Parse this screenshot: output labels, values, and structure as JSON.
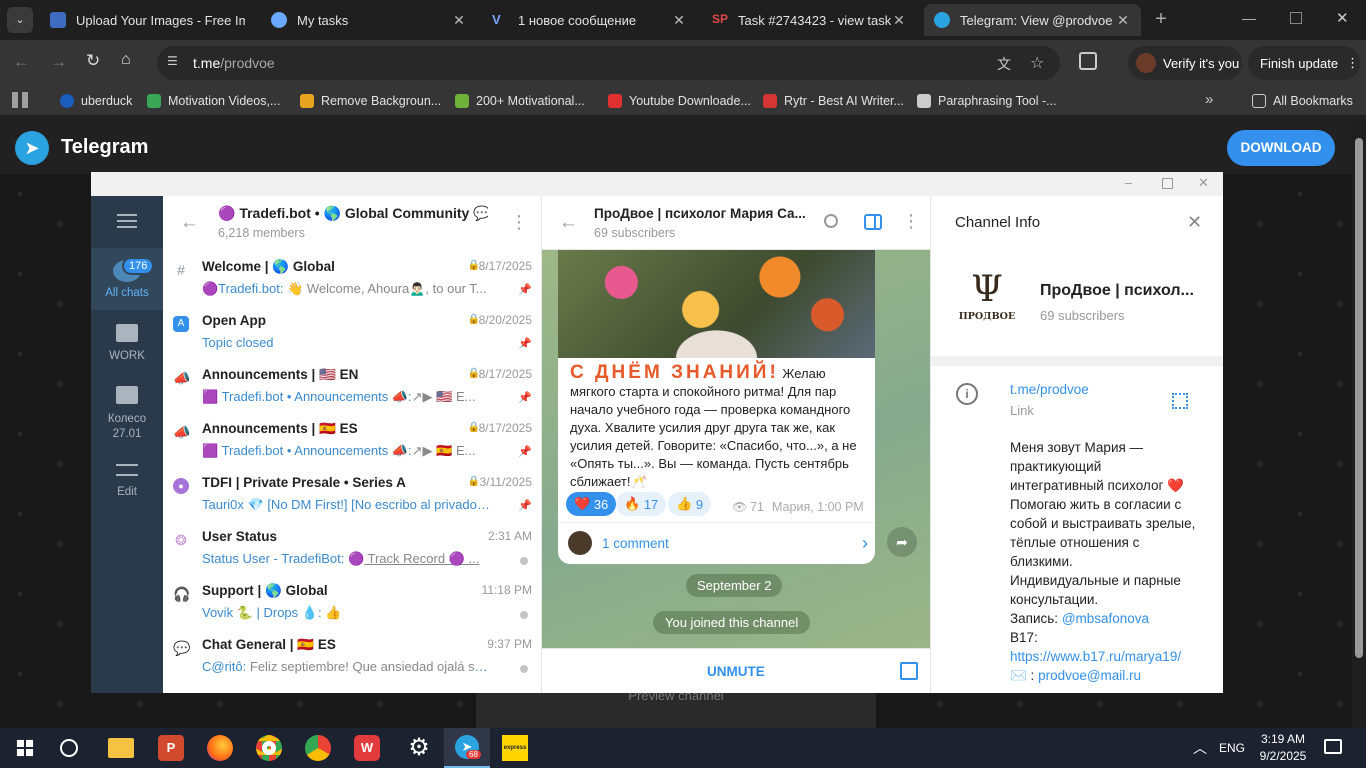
{
  "browser": {
    "tabs": [
      {
        "title": "Upload Your Images - Free Im",
        "favicon_color": "#3d6cc0"
      },
      {
        "title": "My tasks",
        "favicon_color": "#6aa7ff"
      },
      {
        "title": "1 новое сообщение",
        "favicon_color": "#7aa6ff"
      },
      {
        "title": "Task #2743423 - view task",
        "favicon_color": "#e04848"
      },
      {
        "title": "Telegram: View @prodvoe",
        "favicon_color": "#2aa3e0"
      }
    ],
    "url_host": "t.me",
    "url_path": "/prodvoe",
    "profile_label": "Verify it's you",
    "update_label": "Finish update",
    "bookmarks": [
      {
        "label": "uberduck",
        "color": "#1a5dbf"
      },
      {
        "label": "Motivation Videos,...",
        "color": "#3aa657"
      },
      {
        "label": "Remove Backgroun...",
        "color": "#e6a420"
      },
      {
        "label": "200+ Motivational...",
        "color": "#6fb23a"
      },
      {
        "label": "Youtube Downloade...",
        "color": "#e03030"
      },
      {
        "label": "Rytr - Best AI Writer...",
        "color": "#d43535"
      },
      {
        "label": "Paraphrasing Tool -...",
        "color": "#cccccc"
      }
    ],
    "all_bookmarks": "All Bookmarks"
  },
  "telegram_page": {
    "brand": "Telegram",
    "download": "DOWNLOAD",
    "preview_channel": "Preview channel"
  },
  "folders": [
    {
      "label": "All chats",
      "badge": "176"
    },
    {
      "label": "WORK"
    },
    {
      "label": "Колесо 27.01"
    },
    {
      "label": "Edit"
    }
  ],
  "community": {
    "title": "🟣 Tradefi.bot • 🌎 Global Community 💬",
    "members": "6,218 members"
  },
  "chats": [
    {
      "icon": "#",
      "name": "Welcome | 🌎 Global",
      "time": "8/17/2025",
      "preview_sender": "🟣Tradefi.bot:",
      "preview": " 👋 Welcome, Ahoura🙍🏻‍♂️, to our T...",
      "locked": true,
      "pinned": true
    },
    {
      "icon": "▢",
      "name": "Open App",
      "time": "8/20/2025",
      "preview_sender": "Topic closed",
      "preview": "",
      "locked": true,
      "pinned": true
    },
    {
      "icon": "📣",
      "name": "Announcements | 🇺🇸 EN",
      "time": "8/17/2025",
      "preview_sender": "🟪 Tradefi.bot • Announcements 📣:",
      "preview": "↗▶ 🇺🇸 E...",
      "locked": true,
      "pinned": true
    },
    {
      "icon": "📣",
      "name": "Announcements | 🇪🇸 ES",
      "time": "8/17/2025",
      "preview_sender": "🟪 Tradefi.bot • Announcements 📣:",
      "preview": "↗▶ 🇪🇸 E...",
      "locked": true,
      "pinned": true
    },
    {
      "icon": "◉",
      "name": "TDFI | Private Presale • Series A",
      "time": "3/11/2025",
      "preview_sender": "Tauri0x 💎 [No DM First!] [No escribo al privado] ...",
      "preview": "",
      "locked": true,
      "pinned": true
    },
    {
      "icon": "❂",
      "name": "User Status",
      "time": "2:31 AM",
      "preview_sender": "Status User - TradefiBot: 🟣",
      "preview": " Track Record 🟣 ...",
      "locked": false,
      "pinned": false
    },
    {
      "icon": "🎧",
      "name": "Support | 🌎 Global",
      "time": "11:18 PM",
      "preview_sender": "Vovik 🐍",
      "preview": " | Drops 💧: 👍",
      "locked": false,
      "pinned": false
    },
    {
      "icon": "💬",
      "name": "Chat General | 🇪🇸 ES",
      "time": "9:37 PM",
      "preview_sender": "C@ritô:",
      "preview": " Feliz septiembre! Que ansiedad ojalá se an...",
      "locked": false,
      "pinned": false
    }
  ],
  "channel": {
    "name_short": "ПроДвое | психолог Мария Са...",
    "subscribers": "69 subscribers",
    "post_banner": "С ДНЁМ ЗНАНИЙ!",
    "post_text": " Желаю мягкого старта и спокойного ритма! Для пар начало учебного года — проверка командного духа. Хвалите усилия друг друга так же, как усилия детей. Говорите: «Спасибо, что...», а не «Опять ты...». Вы — команда. Пусть сентябрь сближает!🥂",
    "reactions": [
      {
        "emoji": "❤️",
        "count": "36"
      },
      {
        "emoji": "🔥",
        "count": "17"
      },
      {
        "emoji": "👍",
        "count": "9"
      }
    ],
    "views": "71",
    "author_time": "Мария, 1:00 PM",
    "comments": "1 comment",
    "date_chip": "September 2",
    "joined": "You joined this channel",
    "unmute": "UNMUTE"
  },
  "info": {
    "title": "Channel Info",
    "name": "ПроДвое | психол...",
    "subscribers": "69 subscribers",
    "logo_text": "ПРОДВОЕ",
    "link": "t.me/prodvoe",
    "link_label": "Link",
    "bio_lines": [
      "Меня зовут Мария —",
      "практикующий",
      "интегративный психолог ❤️",
      "Помогаю жить в согласии с",
      "собой и выстраивать зрелые,",
      "тёплые отношения с",
      "близкими.",
      "Индивидуальные и парные",
      "консультации."
    ],
    "booking_label": "Запись: ",
    "booking_handle": "@mbsafonova",
    "b17_label": "B17:",
    "b17_link": "https://www.b17.ru/marya19/",
    "email_prefix": "✉️ : ",
    "email": "prodvoe@mail.ru"
  },
  "taskbar": {
    "lang": "ENG",
    "time": "3:19 AM",
    "date": "9/2/2025",
    "telegram_badge": "68"
  }
}
